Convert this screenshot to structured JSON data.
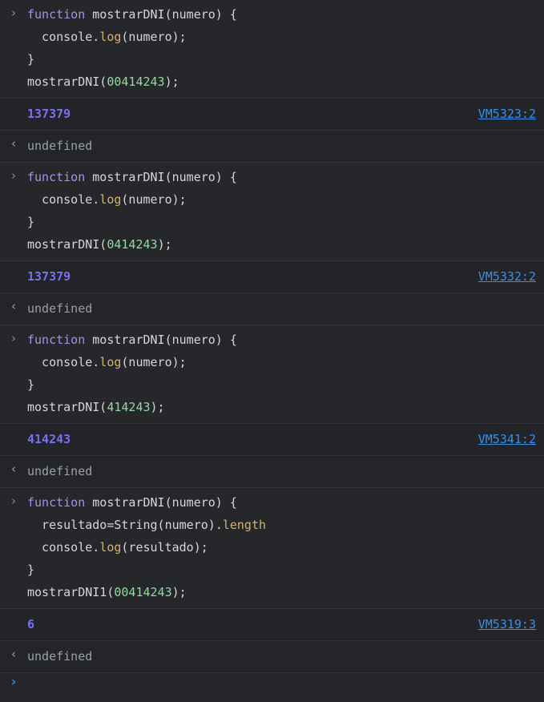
{
  "theme": {
    "background": "#242528",
    "input_row_bg": "#26272b",
    "divider": "#31343a",
    "keyword_color": "#a98fe8",
    "property_color": "#d1b36b",
    "number_literal_color": "#93d8a0",
    "output_number_color": "#7d6df0",
    "link_color": "#3b8eea",
    "undefined_color": "#9aa0a6",
    "plain_color": "#d4d6da",
    "prompt_chevron_color": "#2f7fd4"
  },
  "icons": {
    "input_chevron": "›",
    "output_chevron": "‹",
    "prompt_chevron": "›"
  },
  "entries": [
    {
      "id": "entry-1",
      "input_lines": [
        [
          {
            "t": "function",
            "c": "kw"
          },
          {
            "t": " ",
            "c": "plain"
          },
          {
            "t": "mostrarDNI(numero) {",
            "c": "plain"
          }
        ],
        [
          {
            "t": "  console",
            "c": "obj"
          },
          {
            "t": ".",
            "c": "plain"
          },
          {
            "t": "log",
            "c": "prop"
          },
          {
            "t": "(numero);",
            "c": "plain"
          }
        ],
        [
          {
            "t": "}",
            "c": "plain"
          }
        ],
        [
          {
            "t": "mostrarDNI(",
            "c": "plain"
          },
          {
            "t": "00414243",
            "c": "num"
          },
          {
            "t": ");",
            "c": "plain"
          }
        ]
      ],
      "output": {
        "value": "137379",
        "source": "VM5323:2"
      },
      "result": "undefined"
    },
    {
      "id": "entry-2",
      "input_lines": [
        [
          {
            "t": "function",
            "c": "kw"
          },
          {
            "t": " ",
            "c": "plain"
          },
          {
            "t": "mostrarDNI(numero) {",
            "c": "plain"
          }
        ],
        [
          {
            "t": "  console",
            "c": "obj"
          },
          {
            "t": ".",
            "c": "plain"
          },
          {
            "t": "log",
            "c": "prop"
          },
          {
            "t": "(numero);",
            "c": "plain"
          }
        ],
        [
          {
            "t": "}",
            "c": "plain"
          }
        ],
        [
          {
            "t": "mostrarDNI(",
            "c": "plain"
          },
          {
            "t": "0414243",
            "c": "num"
          },
          {
            "t": ");",
            "c": "plain"
          }
        ]
      ],
      "output": {
        "value": "137379",
        "source": "VM5332:2"
      },
      "result": "undefined"
    },
    {
      "id": "entry-3",
      "input_lines": [
        [
          {
            "t": "function",
            "c": "kw"
          },
          {
            "t": " ",
            "c": "plain"
          },
          {
            "t": "mostrarDNI(numero) {",
            "c": "plain"
          }
        ],
        [
          {
            "t": "  console",
            "c": "obj"
          },
          {
            "t": ".",
            "c": "plain"
          },
          {
            "t": "log",
            "c": "prop"
          },
          {
            "t": "(numero);",
            "c": "plain"
          }
        ],
        [
          {
            "t": "}",
            "c": "plain"
          }
        ],
        [
          {
            "t": "mostrarDNI(",
            "c": "plain"
          },
          {
            "t": "414243",
            "c": "num"
          },
          {
            "t": ");",
            "c": "plain"
          }
        ]
      ],
      "output": {
        "value": "414243",
        "source": "VM5341:2"
      },
      "result": "undefined"
    },
    {
      "id": "entry-4",
      "input_lines": [
        [
          {
            "t": "function",
            "c": "kw"
          },
          {
            "t": " ",
            "c": "plain"
          },
          {
            "t": "mostrarDNI(numero) {",
            "c": "plain"
          }
        ],
        [
          {
            "t": "  resultado=String(numero)",
            "c": "plain"
          },
          {
            "t": ".",
            "c": "plain"
          },
          {
            "t": "length",
            "c": "prop"
          }
        ],
        [
          {
            "t": "  console",
            "c": "obj"
          },
          {
            "t": ".",
            "c": "plain"
          },
          {
            "t": "log",
            "c": "prop"
          },
          {
            "t": "(resultado);",
            "c": "plain"
          }
        ],
        [
          {
            "t": "}",
            "c": "plain"
          }
        ],
        [
          {
            "t": "mostrarDNI1(",
            "c": "plain"
          },
          {
            "t": "00414243",
            "c": "num"
          },
          {
            "t": ");",
            "c": "plain"
          }
        ]
      ],
      "output": {
        "value": "6",
        "source": "VM5319:3"
      },
      "result": "undefined"
    }
  ],
  "prompt": {
    "value": "",
    "placeholder": ""
  }
}
